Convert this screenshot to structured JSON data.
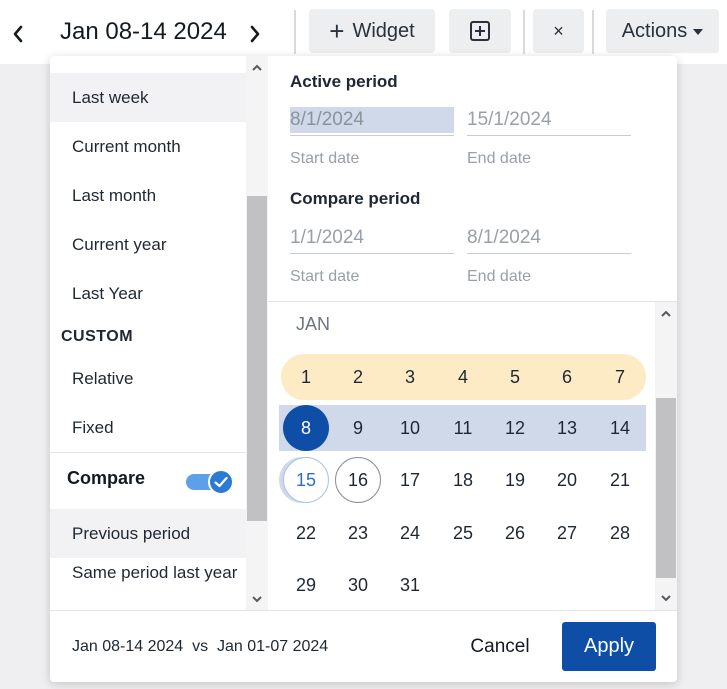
{
  "toolbar": {
    "date_range": "Jan 08-14 2024",
    "widget_label": "Widget",
    "close_label": "×",
    "actions_label": "Actions"
  },
  "presets": {
    "items": [
      "Last week",
      "Current month",
      "Last month",
      "Current year",
      "Last Year"
    ],
    "selected": "Last week",
    "custom_label": "CUSTOM",
    "custom_items": [
      "Relative",
      "Fixed"
    ],
    "compare_label": "Compare",
    "compare_enabled": true,
    "compare_items": [
      "Previous period",
      "Same period last year"
    ],
    "compare_selected": "Previous period"
  },
  "active_period": {
    "title": "Active period",
    "start_value": "8/1/2024",
    "end_value": "15/1/2024",
    "start_help": "Start date",
    "end_help": "End date"
  },
  "compare_period": {
    "title": "Compare period",
    "start_value": "1/1/2024",
    "end_value": "8/1/2024",
    "start_help": "Start date",
    "end_help": "End date"
  },
  "calendar": {
    "month": "JAN",
    "weeks": [
      [
        "1",
        "2",
        "3",
        "4",
        "5",
        "6",
        "7"
      ],
      [
        "8",
        "9",
        "10",
        "11",
        "12",
        "13",
        "14"
      ],
      [
        "15",
        "16",
        "17",
        "18",
        "19",
        "20",
        "21"
      ],
      [
        "22",
        "23",
        "24",
        "25",
        "26",
        "27",
        "28"
      ],
      [
        "29",
        "30",
        "31"
      ]
    ],
    "selected_day": "8",
    "range_start_day": "15",
    "today": "16"
  },
  "footer": {
    "summary": "Jan 08-14 2024  vs  Jan 01-07 2024",
    "cancel_label": "Cancel",
    "apply_label": "Apply"
  },
  "colors": {
    "primary": "#0e4ea6",
    "active_band": "#fdebc6",
    "compare_band": "#cfd9ea",
    "toggle": "#2a7ad6"
  }
}
